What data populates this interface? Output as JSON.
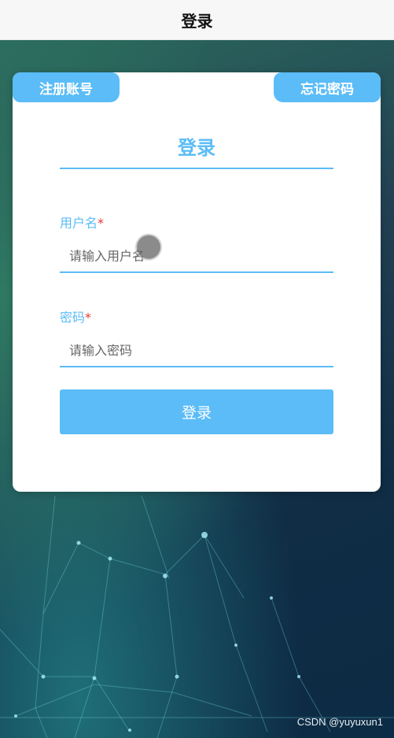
{
  "header": {
    "title": "登录"
  },
  "card": {
    "register_label": "注册账号",
    "forgot_label": "忘记密码",
    "form_title": "登录",
    "username": {
      "label": "用户名",
      "required_mark": "*",
      "placeholder": "请输入用户名",
      "value": ""
    },
    "password": {
      "label": "密码",
      "required_mark": "*",
      "placeholder": "请输入密码",
      "value": ""
    },
    "submit_label": "登录"
  },
  "watermark": "CSDN @yuyuxun1",
  "colors": {
    "accent": "#5bbcf7",
    "required": "#e53935",
    "header_bg": "#f7f7f7"
  }
}
